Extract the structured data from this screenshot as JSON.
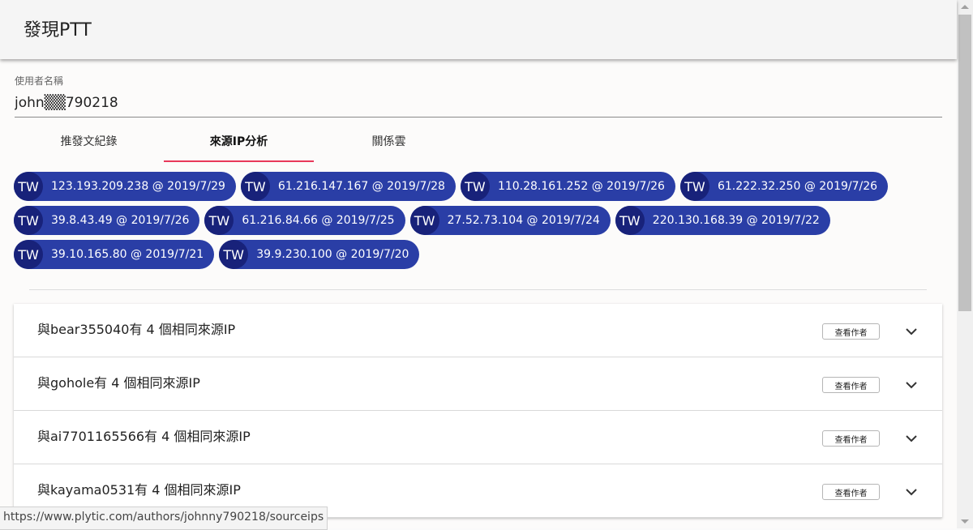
{
  "app": {
    "title": "發現PTT"
  },
  "username": {
    "label": "使用者名稱",
    "value": "john▒▒790218"
  },
  "tabs": [
    {
      "label": "推發文紀錄",
      "active": false
    },
    {
      "label": "來源IP分析",
      "active": true
    },
    {
      "label": "關係雲",
      "active": false
    }
  ],
  "ip_rows": [
    [
      {
        "country": "TW",
        "text": "123.193.209.238 @ 2019/7/29"
      },
      {
        "country": "TW",
        "text": "61.216.147.167 @ 2019/7/28"
      },
      {
        "country": "TW",
        "text": "110.28.161.252 @ 2019/7/26"
      },
      {
        "country": "TW",
        "text": "61.222.32.250 @ 2019/7/26"
      }
    ],
    [
      {
        "country": "TW",
        "text": "39.8.43.49 @ 2019/7/26"
      },
      {
        "country": "TW",
        "text": "61.216.84.66 @ 2019/7/25"
      },
      {
        "country": "TW",
        "text": "27.52.73.104 @ 2019/7/24"
      },
      {
        "country": "TW",
        "text": "220.130.168.39 @ 2019/7/22"
      }
    ],
    [
      {
        "country": "TW",
        "text": "39.10.165.80 @ 2019/7/21"
      },
      {
        "country": "TW",
        "text": "39.9.230.100 @ 2019/7/20"
      }
    ]
  ],
  "panels": [
    {
      "title": "與bear355040有 4 個相同來源IP",
      "button": "查看作者"
    },
    {
      "title": "與gohole有 4 個相同來源IP",
      "button": "查看作者"
    },
    {
      "title": "與ai7701165566有 4 個相同來源IP",
      "button": "查看作者"
    },
    {
      "title": "與kayama0531有 4 個相同來源IP",
      "button": "查看作者"
    }
  ],
  "status_url": "https://www.plytic.com/authors/johnny790218/sourceips",
  "colors": {
    "chip": "#2a3ea6",
    "chip_avatar": "#18227a",
    "tab_indicator": "#e8385a"
  },
  "icons": {
    "panel_expand": "chevron-down-icon"
  }
}
